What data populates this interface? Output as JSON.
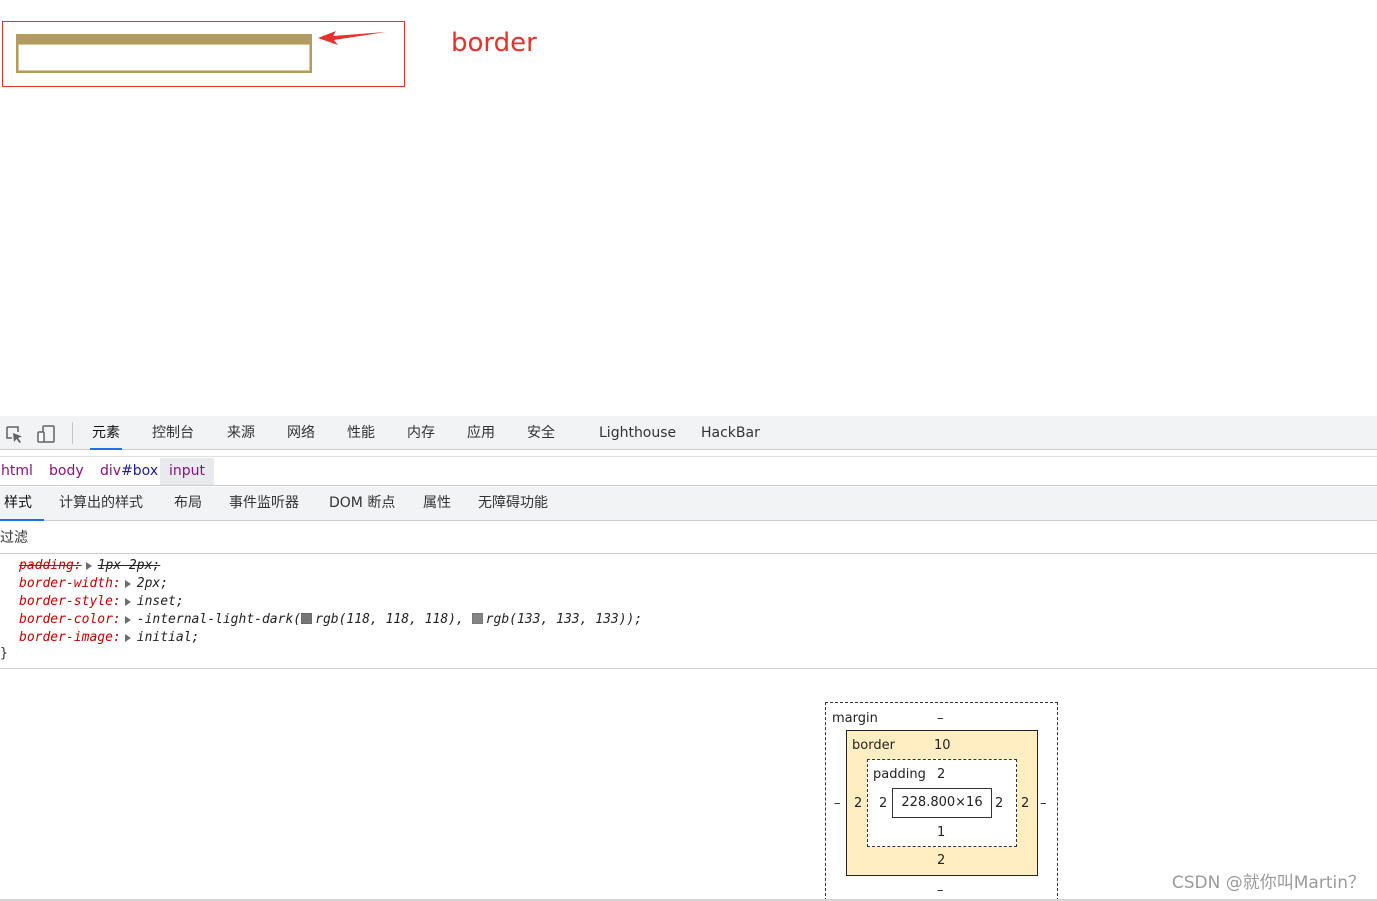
{
  "viewport": {
    "annotation_label": "border",
    "annotation_color": "#e8302c",
    "input_border_color": "#b39a5f"
  },
  "devtools": {
    "main_tabs": [
      {
        "label": "元素",
        "active": true
      },
      {
        "label": "控制台"
      },
      {
        "label": "来源"
      },
      {
        "label": "网络"
      },
      {
        "label": "性能"
      },
      {
        "label": "内存"
      },
      {
        "label": "应用"
      },
      {
        "label": "安全"
      },
      {
        "label": "Lighthouse"
      },
      {
        "label": "HackBar"
      }
    ],
    "tool_icons": [
      "inspect-element-icon",
      "device-toolbar-icon"
    ],
    "breadcrumb": {
      "html": "html",
      "body": "body",
      "div_tag": "div",
      "div_id": "#box",
      "input": "input"
    },
    "sub_tabs": [
      {
        "label": "样式",
        "active": true
      },
      {
        "label": "计算出的样式"
      },
      {
        "label": "布局"
      },
      {
        "label": "事件监听器"
      },
      {
        "label": "DOM 断点"
      },
      {
        "label": "属性"
      },
      {
        "label": "无障碍功能"
      }
    ],
    "filter": {
      "placeholder": "过滤"
    },
    "styles": {
      "declarations": [
        {
          "prop": "padding:",
          "val": "1px 2px;",
          "struck": true
        },
        {
          "prop": "border-width:",
          "val": "2px;"
        },
        {
          "prop": "border-style:",
          "val": "inset;"
        },
        {
          "prop": "border-color:",
          "val_prefix": "-internal-light-dark(",
          "color1": "rgb(118, 118, 118),",
          "color2": "rgb(133, 133, 133));"
        },
        {
          "prop": "border-image:",
          "val": "initial;"
        }
      ],
      "close_brace": "}"
    },
    "box_model": {
      "margin_label": "margin",
      "margin_top": "–",
      "margin_bottom": "–",
      "margin_left": "–",
      "margin_right": "–",
      "border_label": "border",
      "border_top": "10",
      "border_bottom": "2",
      "border_left": "2",
      "border_right": "2",
      "padding_label": "padding",
      "padding_top": "2",
      "padding_bottom": "1",
      "padding_left": "2",
      "padding_right": "2",
      "content_size": "228.800×16",
      "border_fill": "#ffeec2"
    }
  },
  "watermark": "CSDN @就你叫Martin？"
}
